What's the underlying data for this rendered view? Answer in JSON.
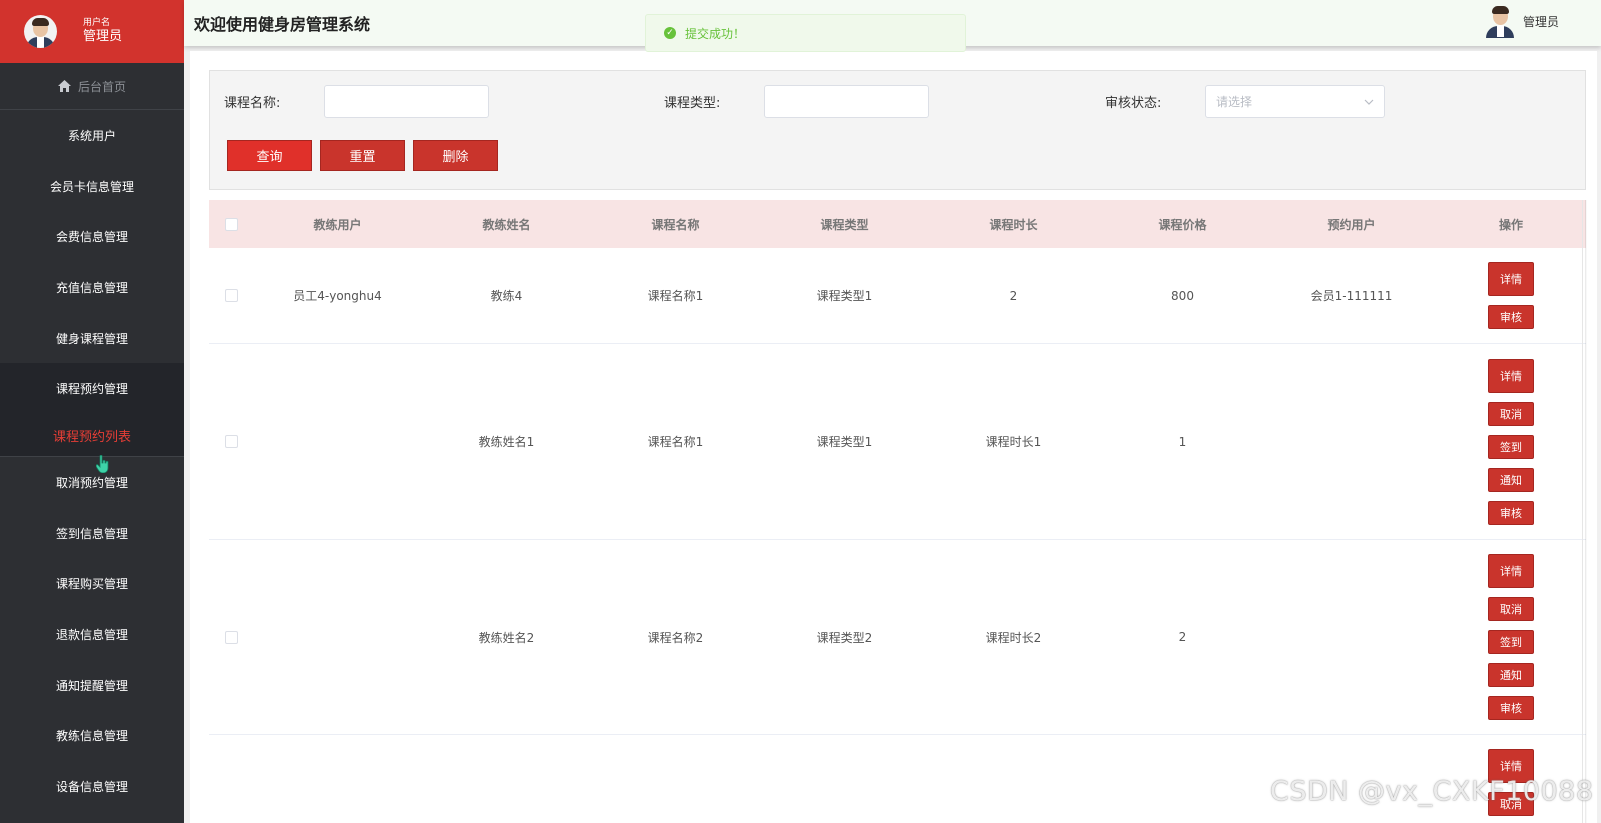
{
  "sidebar": {
    "username_label": "用户名",
    "role": "管理员",
    "home": "后台首页",
    "items_top": [
      "系统用户",
      "会员卡信息管理",
      "会费信息管理",
      "充值信息管理",
      "健身课程管理"
    ],
    "open_menu": "课程预约管理",
    "active_sub": "课程预约列表",
    "items_bottom": [
      "取消预约管理",
      "签到信息管理",
      "课程购买管理",
      "退款信息管理",
      "通知提醒管理",
      "教练信息管理",
      "设备信息管理"
    ]
  },
  "header": {
    "title": "欢迎使用健身房管理系统",
    "user": "管理员"
  },
  "toast": {
    "message": "提交成功！",
    "type": "success"
  },
  "search": {
    "course_name_label": "课程名称:",
    "course_type_label": "课程类型:",
    "audit_label": "审核状态:",
    "audit_placeholder": "请选择",
    "query": "查询",
    "reset": "重置",
    "delete": "删除"
  },
  "table": {
    "headers": [
      "教练用户",
      "教练姓名",
      "课程名称",
      "课程类型",
      "课程时长",
      "课程价格",
      "预约用户",
      "操作"
    ],
    "rows": [
      {
        "coach_user": "员工4-yonghu4",
        "coach_name": "教练4",
        "course_name": "课程名称1",
        "course_type": "课程类型1",
        "duration": "2",
        "price": "800",
        "member": "会员1-111111",
        "actions": [
          "详情",
          "审核"
        ]
      },
      {
        "coach_user": "",
        "coach_name": "教练姓名1",
        "course_name": "课程名称1",
        "course_type": "课程类型1",
        "duration": "课程时长1",
        "price": "1",
        "member": "",
        "actions": [
          "详情",
          "取消",
          "签到",
          "通知",
          "审核"
        ]
      },
      {
        "coach_user": "",
        "coach_name": "教练姓名2",
        "course_name": "课程名称2",
        "course_type": "课程类型2",
        "duration": "课程时长2",
        "price": "2",
        "member": "",
        "actions": [
          "详情",
          "取消",
          "签到",
          "通知",
          "审核"
        ]
      },
      {
        "actions": [
          "详情",
          "取消"
        ]
      }
    ]
  },
  "watermark": "CSDN @vx_CXKF10088",
  "colors": {
    "primary": "#d2332d",
    "sidebar": "#2d2f33",
    "success": "#67c23a",
    "header_row": "#f8e4e4"
  }
}
